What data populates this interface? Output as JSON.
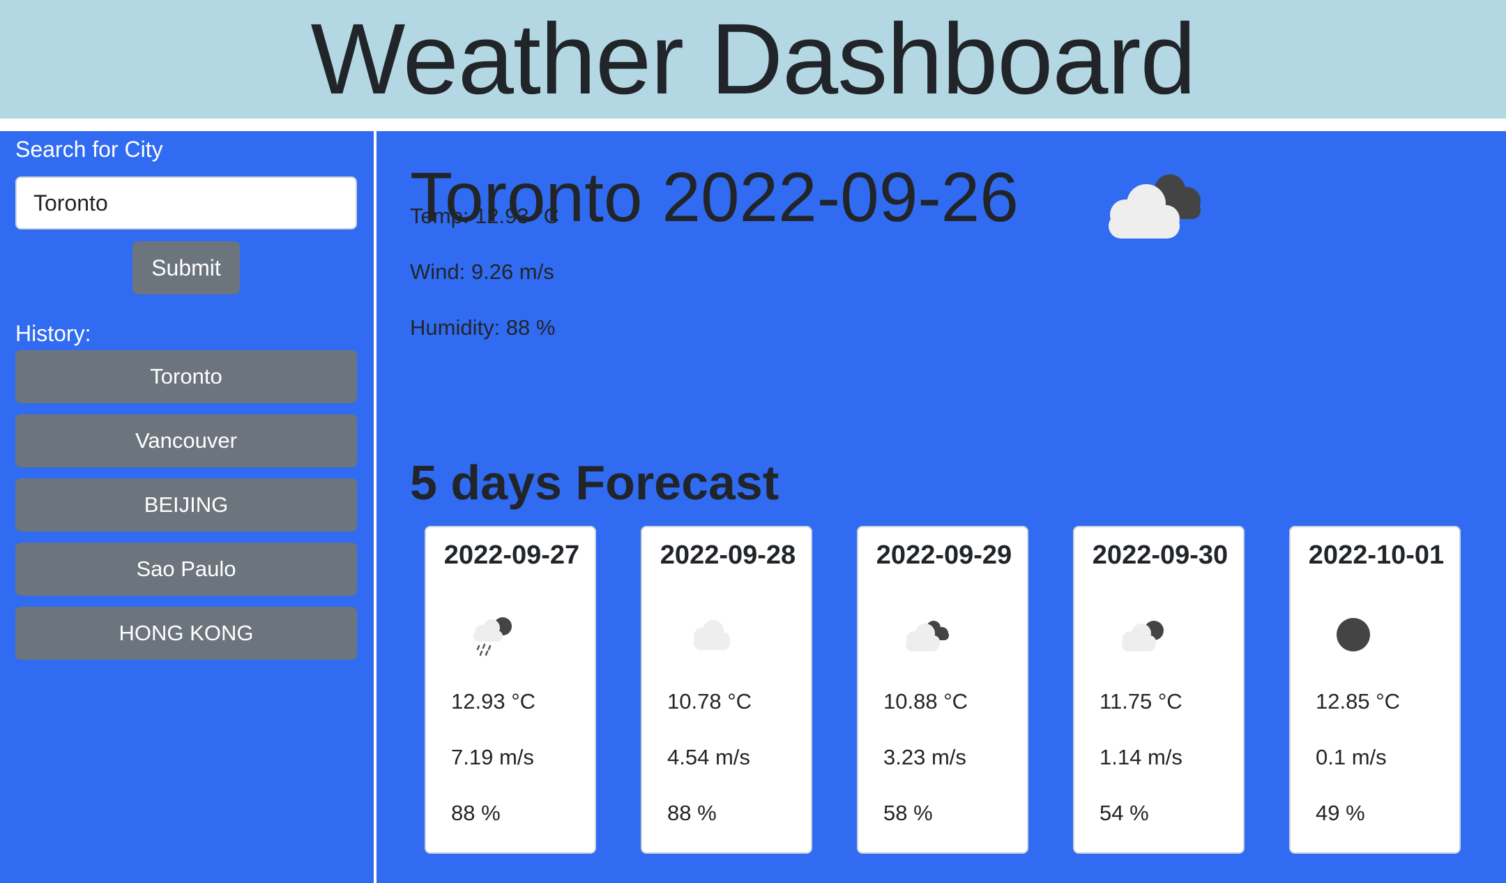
{
  "header": {
    "title": "Weather Dashboard"
  },
  "sidebar": {
    "search_label": "Search for City",
    "search_value": "Toronto",
    "submit_label": "Submit",
    "history_label": "History:",
    "history": [
      "Toronto",
      "Vancouver",
      "BEIJING",
      "Sao Paulo",
      "HONG KONG"
    ]
  },
  "today": {
    "title": "Toronto 2022-09-26",
    "icon": "broken-clouds-icon",
    "temp": "Temp: 12.93 °C",
    "wind": "Wind: 9.26 m/s",
    "humidity": "Humidity: 88 %"
  },
  "forecast": {
    "title": "5 days Forecast",
    "days": [
      {
        "date": "2022-09-27",
        "icon": "rain-icon",
        "temp": "12.93 °C",
        "wind": "7.19 m/s",
        "humidity": "88 %"
      },
      {
        "date": "2022-09-28",
        "icon": "cloud-icon",
        "temp": "10.78 °C",
        "wind": "4.54 m/s",
        "humidity": "88 %"
      },
      {
        "date": "2022-09-29",
        "icon": "broken-clouds-icon",
        "temp": "10.88 °C",
        "wind": "3.23 m/s",
        "humidity": "58 %"
      },
      {
        "date": "2022-09-30",
        "icon": "few-clouds-icon",
        "temp": "11.75 °C",
        "wind": "1.14 m/s",
        "humidity": "54 %"
      },
      {
        "date": "2022-10-01",
        "icon": "clear-sky-icon",
        "temp": "12.85 °C",
        "wind": "0.1 m/s",
        "humidity": "49 %"
      }
    ]
  },
  "colors": {
    "header_bg": "#b4d8e3",
    "panel_bg": "#316bf1",
    "button_bg": "#6c757d",
    "text": "#212529"
  }
}
